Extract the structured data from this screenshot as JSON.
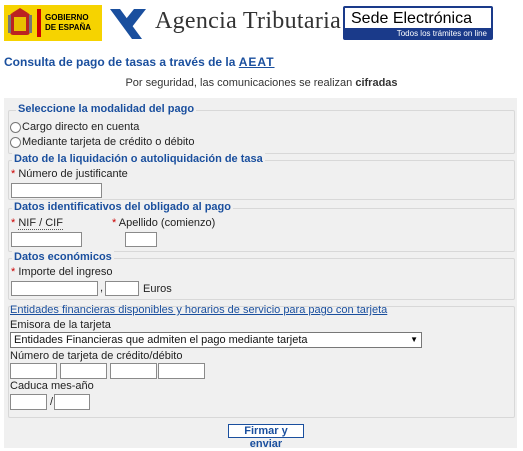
{
  "header": {
    "gob_line1": "GOBIERNO",
    "gob_line2": "DE ESPAÑA",
    "agency": "Agencia Tributaria",
    "sede_title": "Sede Electrónica",
    "sede_sub": "Todos los trámites on line",
    "colors": {
      "gob_yellow": "#f6d300",
      "gob_red": "#c00000",
      "sede_blue": "#1a3a8a",
      "accent": "#1a4f9e"
    },
    "icons": [
      "crest-icon",
      "aeat-logo-icon"
    ]
  },
  "page": {
    "title_prefix": "Consulta de pago de tasas a través de la ",
    "title_aeat": "AEAT",
    "security_prefix": "Por seguridad, las comunicaciones se realizan ",
    "security_bold": "cifradas"
  },
  "modalidad": {
    "legend": "Seleccione la modalidad del pago",
    "option1": "Cargo directo en cuenta",
    "option2": "Mediante tarjeta de crédito o débito"
  },
  "liquidacion": {
    "legend": "Dato de la liquidación o autoliquidación de tasa",
    "asterisk": "*",
    "numero_label": "Número de justificante",
    "numero_value": ""
  },
  "obligado": {
    "legend": "Datos identificativos del obligado al pago",
    "asterisk": "*",
    "nif_label": "NIF / CIF",
    "nif_value": "",
    "apellido_label": "Apellido (comienzo)",
    "apellido_value": ""
  },
  "economicos": {
    "legend": "Datos económicos",
    "asterisk": "*",
    "importe_label": "Importe del ingreso",
    "importe_entero": "",
    "comma": ",",
    "importe_decimal": "",
    "euros": "Euros"
  },
  "tarjeta": {
    "entidades_link": "Entidades financieras disponibles y horarios de servicio para pago con tarjeta",
    "emisora_label": "Emisora de la tarjeta",
    "emisora_selected": "Entidades Financieras que admiten el pago mediante tarjeta",
    "numero_label": "Número de tarjeta de crédito/débito",
    "caduca_label": "Caduca mes-año",
    "slash": "/"
  },
  "actions": {
    "submit": "Firmar y enviar"
  }
}
